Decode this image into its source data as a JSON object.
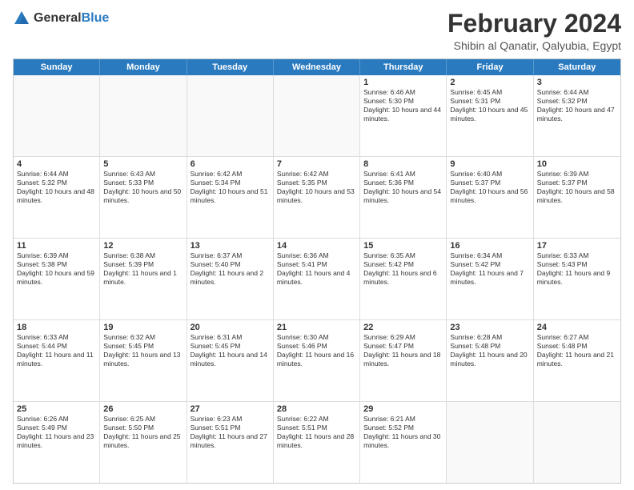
{
  "logo": {
    "general": "General",
    "blue": "Blue"
  },
  "header": {
    "month": "February 2024",
    "location": "Shibin al Qanatir, Qalyubia, Egypt"
  },
  "weekdays": [
    "Sunday",
    "Monday",
    "Tuesday",
    "Wednesday",
    "Thursday",
    "Friday",
    "Saturday"
  ],
  "weeks": [
    [
      {
        "day": "",
        "empty": true
      },
      {
        "day": "",
        "empty": true
      },
      {
        "day": "",
        "empty": true
      },
      {
        "day": "",
        "empty": true
      },
      {
        "day": "1",
        "sunrise": "6:46 AM",
        "sunset": "5:30 PM",
        "daylight": "10 hours and 44 minutes."
      },
      {
        "day": "2",
        "sunrise": "6:45 AM",
        "sunset": "5:31 PM",
        "daylight": "10 hours and 45 minutes."
      },
      {
        "day": "3",
        "sunrise": "6:44 AM",
        "sunset": "5:32 PM",
        "daylight": "10 hours and 47 minutes."
      }
    ],
    [
      {
        "day": "4",
        "sunrise": "6:44 AM",
        "sunset": "5:32 PM",
        "daylight": "10 hours and 48 minutes."
      },
      {
        "day": "5",
        "sunrise": "6:43 AM",
        "sunset": "5:33 PM",
        "daylight": "10 hours and 50 minutes."
      },
      {
        "day": "6",
        "sunrise": "6:42 AM",
        "sunset": "5:34 PM",
        "daylight": "10 hours and 51 minutes."
      },
      {
        "day": "7",
        "sunrise": "6:42 AM",
        "sunset": "5:35 PM",
        "daylight": "10 hours and 53 minutes."
      },
      {
        "day": "8",
        "sunrise": "6:41 AM",
        "sunset": "5:36 PM",
        "daylight": "10 hours and 54 minutes."
      },
      {
        "day": "9",
        "sunrise": "6:40 AM",
        "sunset": "5:37 PM",
        "daylight": "10 hours and 56 minutes."
      },
      {
        "day": "10",
        "sunrise": "6:39 AM",
        "sunset": "5:37 PM",
        "daylight": "10 hours and 58 minutes."
      }
    ],
    [
      {
        "day": "11",
        "sunrise": "6:39 AM",
        "sunset": "5:38 PM",
        "daylight": "10 hours and 59 minutes."
      },
      {
        "day": "12",
        "sunrise": "6:38 AM",
        "sunset": "5:39 PM",
        "daylight": "11 hours and 1 minute."
      },
      {
        "day": "13",
        "sunrise": "6:37 AM",
        "sunset": "5:40 PM",
        "daylight": "11 hours and 2 minutes."
      },
      {
        "day": "14",
        "sunrise": "6:36 AM",
        "sunset": "5:41 PM",
        "daylight": "11 hours and 4 minutes."
      },
      {
        "day": "15",
        "sunrise": "6:35 AM",
        "sunset": "5:42 PM",
        "daylight": "11 hours and 6 minutes."
      },
      {
        "day": "16",
        "sunrise": "6:34 AM",
        "sunset": "5:42 PM",
        "daylight": "11 hours and 7 minutes."
      },
      {
        "day": "17",
        "sunrise": "6:33 AM",
        "sunset": "5:43 PM",
        "daylight": "11 hours and 9 minutes."
      }
    ],
    [
      {
        "day": "18",
        "sunrise": "6:33 AM",
        "sunset": "5:44 PM",
        "daylight": "11 hours and 11 minutes."
      },
      {
        "day": "19",
        "sunrise": "6:32 AM",
        "sunset": "5:45 PM",
        "daylight": "11 hours and 13 minutes."
      },
      {
        "day": "20",
        "sunrise": "6:31 AM",
        "sunset": "5:45 PM",
        "daylight": "11 hours and 14 minutes."
      },
      {
        "day": "21",
        "sunrise": "6:30 AM",
        "sunset": "5:46 PM",
        "daylight": "11 hours and 16 minutes."
      },
      {
        "day": "22",
        "sunrise": "6:29 AM",
        "sunset": "5:47 PM",
        "daylight": "11 hours and 18 minutes."
      },
      {
        "day": "23",
        "sunrise": "6:28 AM",
        "sunset": "5:48 PM",
        "daylight": "11 hours and 20 minutes."
      },
      {
        "day": "24",
        "sunrise": "6:27 AM",
        "sunset": "5:48 PM",
        "daylight": "11 hours and 21 minutes."
      }
    ],
    [
      {
        "day": "25",
        "sunrise": "6:26 AM",
        "sunset": "5:49 PM",
        "daylight": "11 hours and 23 minutes."
      },
      {
        "day": "26",
        "sunrise": "6:25 AM",
        "sunset": "5:50 PM",
        "daylight": "11 hours and 25 minutes."
      },
      {
        "day": "27",
        "sunrise": "6:23 AM",
        "sunset": "5:51 PM",
        "daylight": "11 hours and 27 minutes."
      },
      {
        "day": "28",
        "sunrise": "6:22 AM",
        "sunset": "5:51 PM",
        "daylight": "11 hours and 28 minutes."
      },
      {
        "day": "29",
        "sunrise": "6:21 AM",
        "sunset": "5:52 PM",
        "daylight": "11 hours and 30 minutes."
      },
      {
        "day": "",
        "empty": true
      },
      {
        "day": "",
        "empty": true
      }
    ]
  ]
}
